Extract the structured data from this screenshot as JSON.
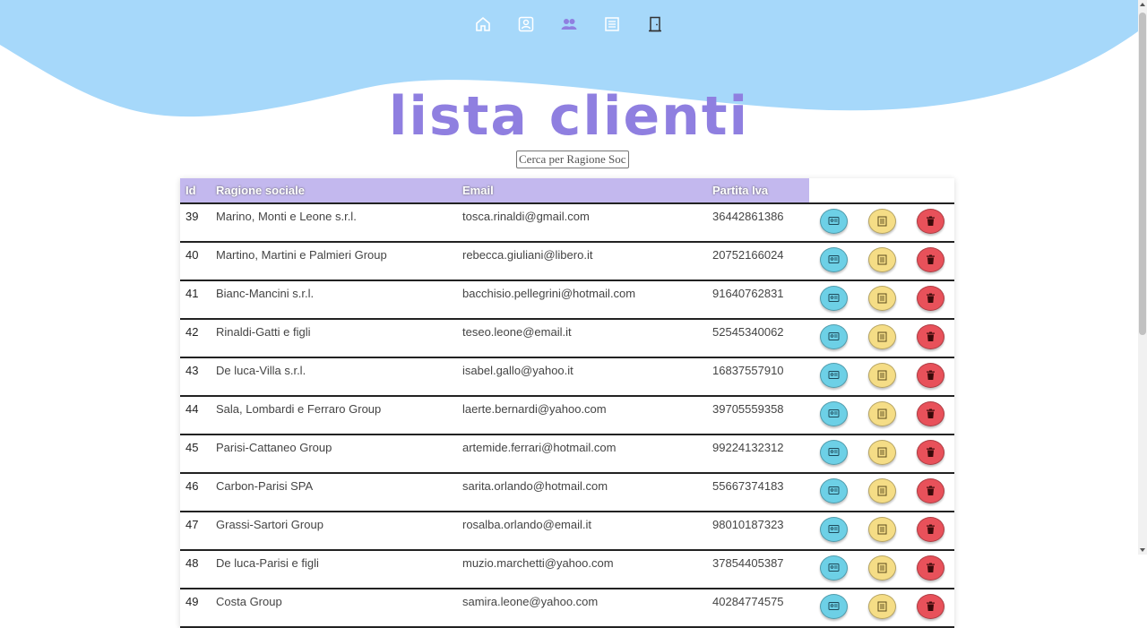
{
  "colors": {
    "header_wave": "#a6d8fa",
    "title": "#8f7fe0",
    "table_header": "#c3b8ee",
    "view_button": "#6dd0e6",
    "detail_button": "#f5dd86",
    "delete_button": "#e8515a"
  },
  "nav": {
    "items": [
      {
        "icon": "home-icon"
      },
      {
        "icon": "user-icon"
      },
      {
        "icon": "users-icon"
      },
      {
        "icon": "invoice-icon"
      },
      {
        "icon": "logout-icon"
      }
    ]
  },
  "page": {
    "title": "lista clienti"
  },
  "search": {
    "placeholder": "Cerca per Ragione Sociale",
    "value": ""
  },
  "table": {
    "columns": [
      "Id",
      "Ragione sociale",
      "Email",
      "Partita Iva"
    ],
    "rows": [
      {
        "id": "39",
        "ragione": "Marino, Monti e Leone s.r.l.",
        "email": "tosca.rinaldi@gmail.com",
        "piva": "36442861386"
      },
      {
        "id": "40",
        "ragione": "Martino, Martini e Palmieri Group",
        "email": "rebecca.giuliani@libero.it",
        "piva": "20752166024"
      },
      {
        "id": "41",
        "ragione": "Bianc-Mancini s.r.l.",
        "email": "bacchisio.pellegrini@hotmail.com",
        "piva": "91640762831"
      },
      {
        "id": "42",
        "ragione": "Rinaldi-Gatti e figli",
        "email": "teseo.leone@email.it",
        "piva": "52545340062"
      },
      {
        "id": "43",
        "ragione": "De luca-Villa s.r.l.",
        "email": "isabel.gallo@yahoo.it",
        "piva": "16837557910"
      },
      {
        "id": "44",
        "ragione": "Sala, Lombardi e Ferraro Group",
        "email": "laerte.bernardi@yahoo.com",
        "piva": "39705559358"
      },
      {
        "id": "45",
        "ragione": "Parisi-Cattaneo Group",
        "email": "artemide.ferrari@hotmail.com",
        "piva": "99224132312"
      },
      {
        "id": "46",
        "ragione": "Carbon-Parisi SPA",
        "email": "sarita.orlando@hotmail.com",
        "piva": "55667374183"
      },
      {
        "id": "47",
        "ragione": "Grassi-Sartori Group",
        "email": "rosalba.orlando@email.it",
        "piva": "98010187323"
      },
      {
        "id": "48",
        "ragione": "De luca-Parisi e figli",
        "email": "muzio.marchetti@yahoo.com",
        "piva": "37854405387"
      },
      {
        "id": "49",
        "ragione": "Costa Group",
        "email": "samira.leone@yahoo.com",
        "piva": "40284774575"
      }
    ],
    "actions": [
      {
        "name": "view-client-button",
        "icon": "id-card-icon"
      },
      {
        "name": "detail-client-button",
        "icon": "document-icon"
      },
      {
        "name": "delete-client-button",
        "icon": "trash-icon"
      }
    ]
  }
}
